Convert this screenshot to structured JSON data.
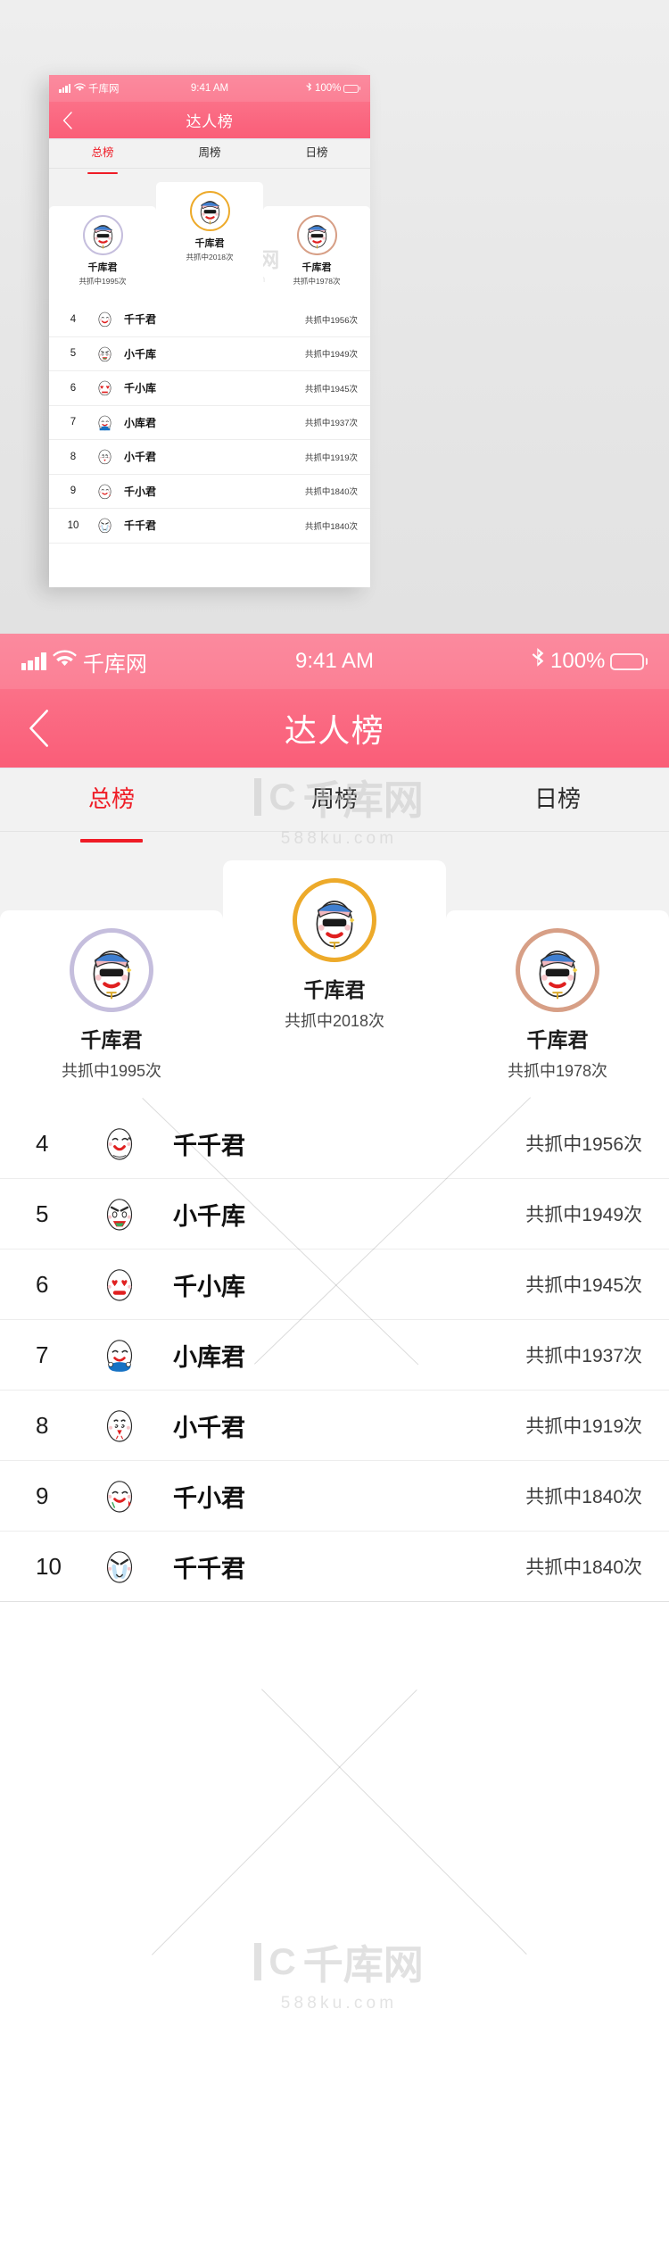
{
  "statusbar": {
    "carrier": "千库网",
    "time": "9:41 AM",
    "battery_pct": "100%",
    "icons": [
      "signal-icon",
      "wifi-icon",
      "bluetooth-icon",
      "battery-icon"
    ]
  },
  "navbar": {
    "title": "达人榜",
    "back_label": "‹"
  },
  "tabs": [
    {
      "label": "总榜",
      "active": true
    },
    {
      "label": "周榜",
      "active": false
    },
    {
      "label": "日榜",
      "active": false
    }
  ],
  "podium": [
    {
      "rank": 2,
      "name": "千库君",
      "score": "共抓中1995次",
      "ring_color": "#c5bedd",
      "position": "left"
    },
    {
      "rank": 1,
      "name": "千库君",
      "score": "共抓中2018次",
      "ring_color": "#edaa2a",
      "position": "center"
    },
    {
      "rank": 3,
      "name": "千库君",
      "score": "共抓中1978次",
      "ring_color": "#d79f86",
      "position": "right"
    }
  ],
  "list": {
    "rows": [
      {
        "rank": "4",
        "name": "千千君",
        "score": "共抓中1956次",
        "face": "wink"
      },
      {
        "rank": "5",
        "name": "小千库",
        "score": "共抓中1949次",
        "face": "angry"
      },
      {
        "rank": "6",
        "name": "千小库",
        "score": "共抓中1945次",
        "face": "love"
      },
      {
        "rank": "7",
        "name": "小库君",
        "score": "共抓中1937次",
        "face": "blue"
      },
      {
        "rank": "8",
        "name": "小千君",
        "score": "共抓中1919次",
        "face": "sick"
      },
      {
        "rank": "9",
        "name": "千小君",
        "score": "共抓中1840次",
        "face": "happy"
      },
      {
        "rank": "10",
        "name": "千千君",
        "score": "共抓中1840次",
        "face": "cry"
      }
    ]
  },
  "watermark": {
    "brand": "千库网",
    "site": "588ku.com"
  },
  "colors": {
    "accent_red": "#ef1c26",
    "header_pink_top": "#fb7188",
    "header_pink_bottom": "#fa5d78",
    "statusbar_pink": "#fb8a9e",
    "page_bg": "#f2f2f2"
  }
}
